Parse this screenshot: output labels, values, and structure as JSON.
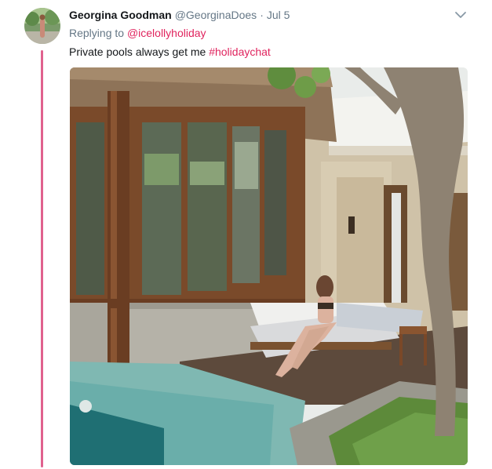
{
  "tweet": {
    "author": {
      "display_name": "Georgina Goodman",
      "handle": "@GeorginaDoes",
      "avatar_icon": "avatar-photo"
    },
    "separator": "·",
    "timestamp": "Jul 5",
    "replying_prefix": "Replying to",
    "replying_to": "@icelollyholiday",
    "text": "Private pools always get me",
    "hashtag": "#holidaychat",
    "menu_icon": "chevron-down-icon",
    "media_description_icon": "photo"
  },
  "colors": {
    "accent": "#e0245e",
    "thread_line": "#e0618e",
    "muted_text": "#657786",
    "primary_text": "#14171a"
  }
}
